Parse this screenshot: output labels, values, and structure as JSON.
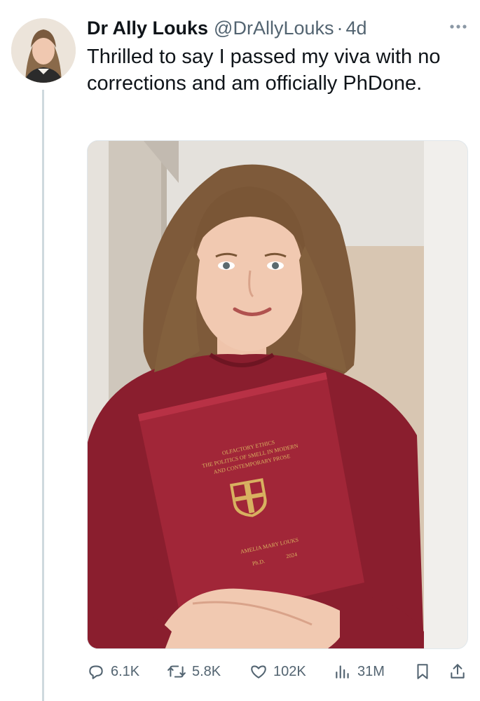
{
  "author": {
    "name": "Dr Ally Louks",
    "handle": "@DrAllyLouks",
    "separator": "·",
    "time": "4d"
  },
  "tweet": {
    "text": "Thrilled to say I passed my viva with no corrections and am officially PhDone."
  },
  "media": {
    "thesis_cover": {
      "title_line1": "OLFACTORY ETHICS",
      "title_line2": "THE POLITICS OF SMELL IN MODERN",
      "title_line3": "AND CONTEMPORARY PROSE",
      "author": "AMELIA MARY LOUKS",
      "degree": "Ph.D.",
      "year": "2024"
    }
  },
  "actions": {
    "reply_count": "6.1K",
    "retweet_count": "5.8K",
    "like_count": "102K",
    "view_count": "31M"
  },
  "icons": {
    "more": "more-options-icon",
    "reply": "reply-icon",
    "retweet": "retweet-icon",
    "like": "heart-icon",
    "views": "views-icon",
    "bookmark": "bookmark-icon",
    "share": "share-icon"
  },
  "colors": {
    "text": "#0f1419",
    "secondary": "#536471",
    "thread_line": "#cfd9de",
    "sweater": "#8a1e2e",
    "thesis": "#a12638",
    "gold": "#d8b160"
  }
}
